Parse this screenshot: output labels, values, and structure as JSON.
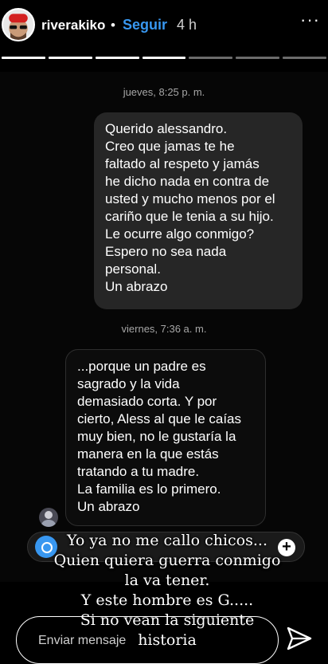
{
  "header": {
    "username": "riverakiko",
    "separator": "•",
    "follow_label": "Seguir",
    "time_ago": "4 h",
    "more_label": "···"
  },
  "progress": {
    "segments_total": 7,
    "segments_viewed": 4
  },
  "dm": {
    "timestamp_1": "jueves, 8:25 p. m.",
    "message_1": "Querido alessandro.\nCreo que jamas te he\nfaltado al respeto y jamás\nhe dicho nada en contra de\nusted y mucho menos por el\ncariño que le tenia a su hijo.\nLe ocurre algo conmigo?\nEspero no sea nada\npersonal.\nUn abrazo",
    "timestamp_2": "viernes, 7:36 a. m.",
    "message_2": "...porque un padre es\nsagrado y la vida\ndemasiado corta. Y por\ncierto, Aless al que le caías\nmuy bien, no le gustaría la\nmanera en la que estás\ntratando a tu madre.\nLa familia es lo primero.\nUn abrazo"
  },
  "caption": "Yo ya no me callo chicos...\nQuien quiera guerra conmigo\nla va tener.\nY este hombre es G.....\nSi no vean la siguiente\nhistoria",
  "reply": {
    "placeholder": "Enviar mensaje"
  },
  "colors": {
    "accent": "#3897f0",
    "background": "#000000",
    "bubble": "#262626"
  }
}
